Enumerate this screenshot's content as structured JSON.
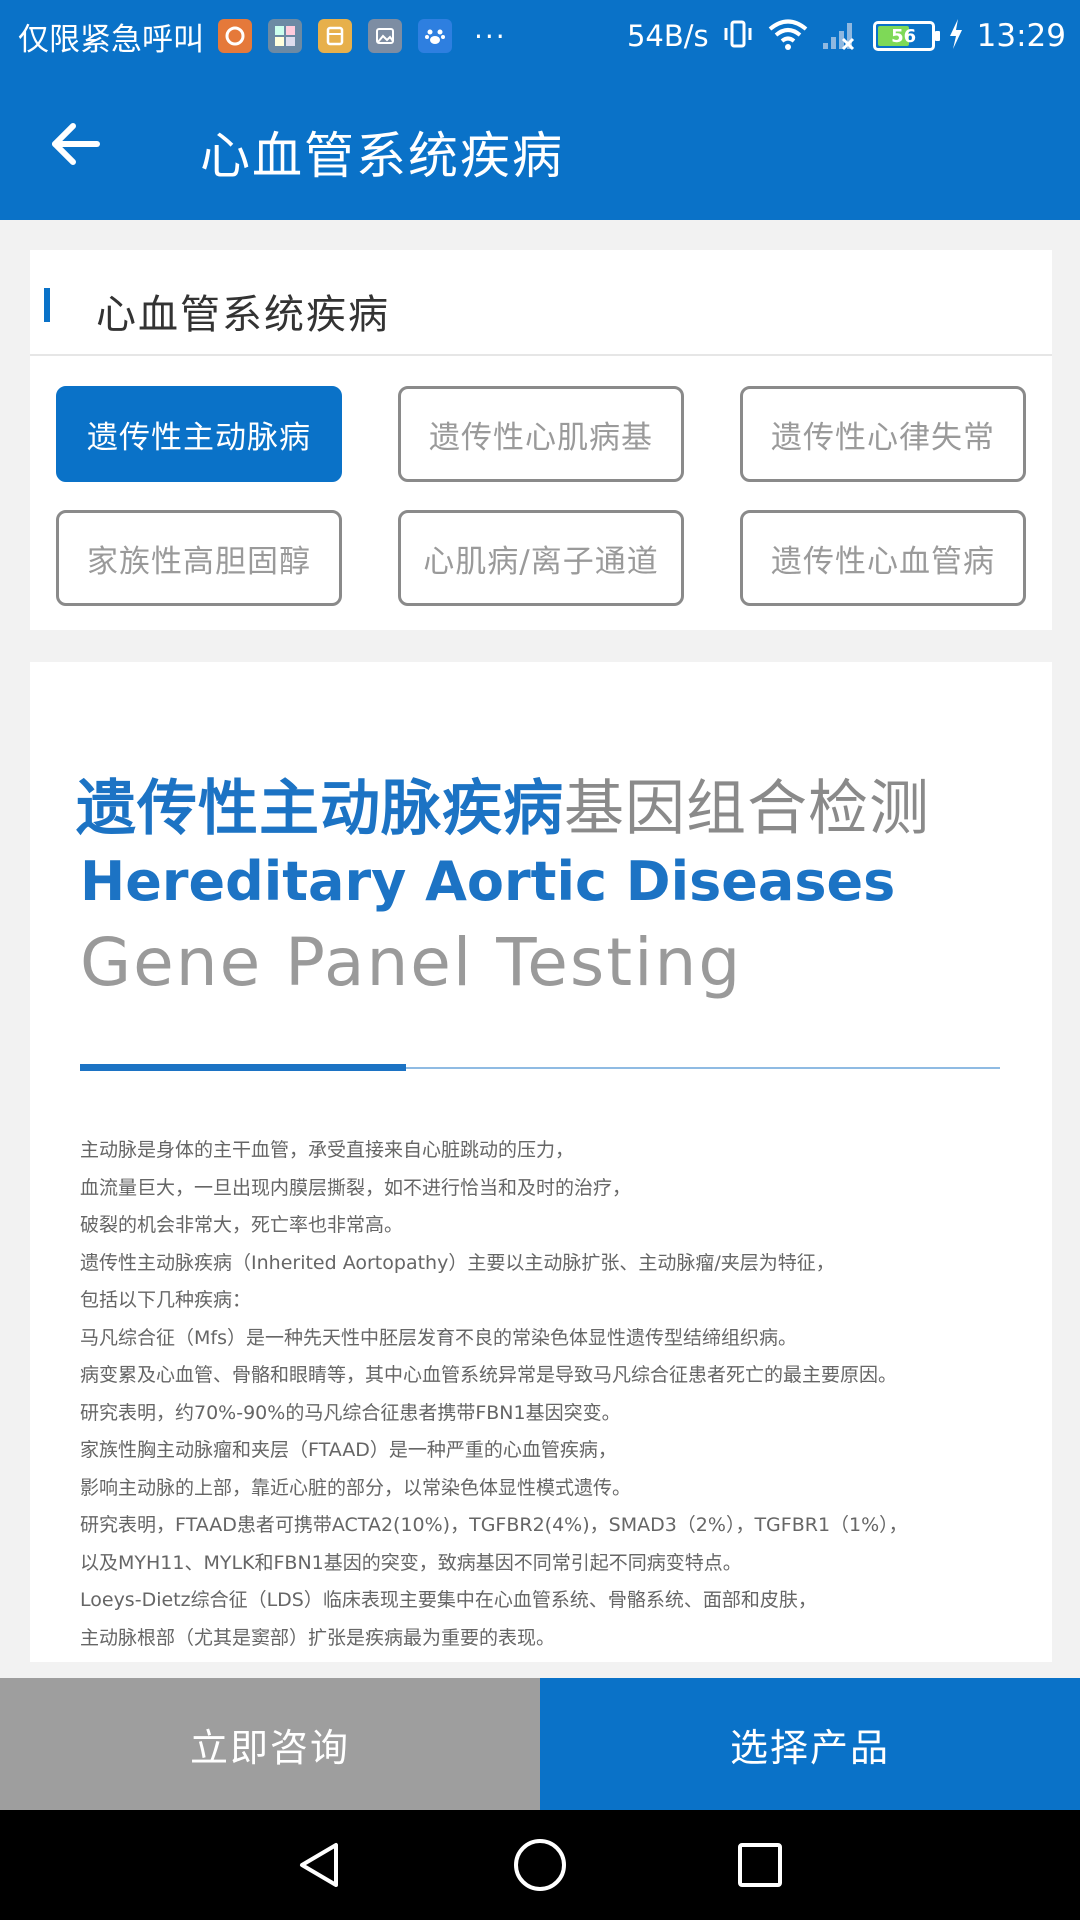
{
  "status_bar": {
    "carrier": "仅限紧急呼叫",
    "overflow": "···",
    "net_speed": "54B/s",
    "battery_level": "56",
    "time": "13:29",
    "notification_icons": [
      "uc-browser-icon",
      "gallery-app-icon",
      "file-manager-icon",
      "image-icon",
      "baidu-icon"
    ],
    "icons": [
      "vibrate-icon",
      "wifi-icon",
      "signal-icon",
      "battery-icon",
      "charging-icon"
    ]
  },
  "header": {
    "back_icon": "arrow-left-icon",
    "title": "心血管系统疾病"
  },
  "category": {
    "section_title": "心血管系统疾病",
    "chips": [
      {
        "label": "遗传性主动脉病",
        "active": true
      },
      {
        "label": "遗传性心肌病基",
        "active": false
      },
      {
        "label": "遗传性心律失常",
        "active": false
      },
      {
        "label": "家族性高胆固醇",
        "active": false
      },
      {
        "label": "心肌病/离子通道",
        "active": false
      },
      {
        "label": "遗传性心血管病",
        "active": false
      }
    ]
  },
  "detail": {
    "headline_cn_bold": "遗传性主动脉疾病",
    "headline_cn_rest": "基因组合检测",
    "headline_en_1": "Hereditary Aortic Diseases",
    "headline_en_2": "Gene Panel Testing",
    "paragraphs": [
      "主动脉是身体的主干血管，承受直接来自心脏跳动的压力，",
      "血流量巨大，一旦出现内膜层撕裂，如不进行恰当和及时的治疗，",
      "破裂的机会非常大，死亡率也非常高。",
      "遗传性主动脉疾病（Inherited Aortopathy）主要以主动脉扩张、主动脉瘤/夹层为特征，",
      "包括以下几种疾病：",
      "马凡综合征（Mfs）是一种先天性中胚层发育不良的常染色体显性遗传型结缔组织病。",
      "病变累及心血管、骨骼和眼睛等，其中心血管系统异常是导致马凡综合征患者死亡的最主要原因。",
      "研究表明，约70%-90%的马凡综合征患者携带FBN1基因突变。",
      "家族性胸主动脉瘤和夹层（FTAAD）是一种严重的心血管疾病，",
      "影响主动脉的上部，靠近心脏的部分，以常染色体显性模式遗传。",
      "研究表明，FTAAD患者可携带ACTA2(10%)，TGFBR2(4%)，SMAD3（2%），TGFBR1（1%），",
      "以及MYH11、MYLK和FBN1基因的突变，致病基因不同常引起不同病变特点。",
      "Loeys-Dietz综合征（LDS）临床表现主要集中在心血管系统、骨骼系统、面部和皮肤，",
      "主动脉根部（尤其是窦部）扩张是疾病最为重要的表现。"
    ]
  },
  "actions": {
    "consult_label": "立即咨询",
    "select_label": "选择产品"
  },
  "nav": {
    "back_icon": "triangle-back-icon",
    "home_icon": "circle-home-icon",
    "recents_icon": "square-recents-icon"
  },
  "colors": {
    "primary": "#0a72c8",
    "heading_blue": "#1c73c4",
    "consult_gray": "#9e9e9e"
  }
}
